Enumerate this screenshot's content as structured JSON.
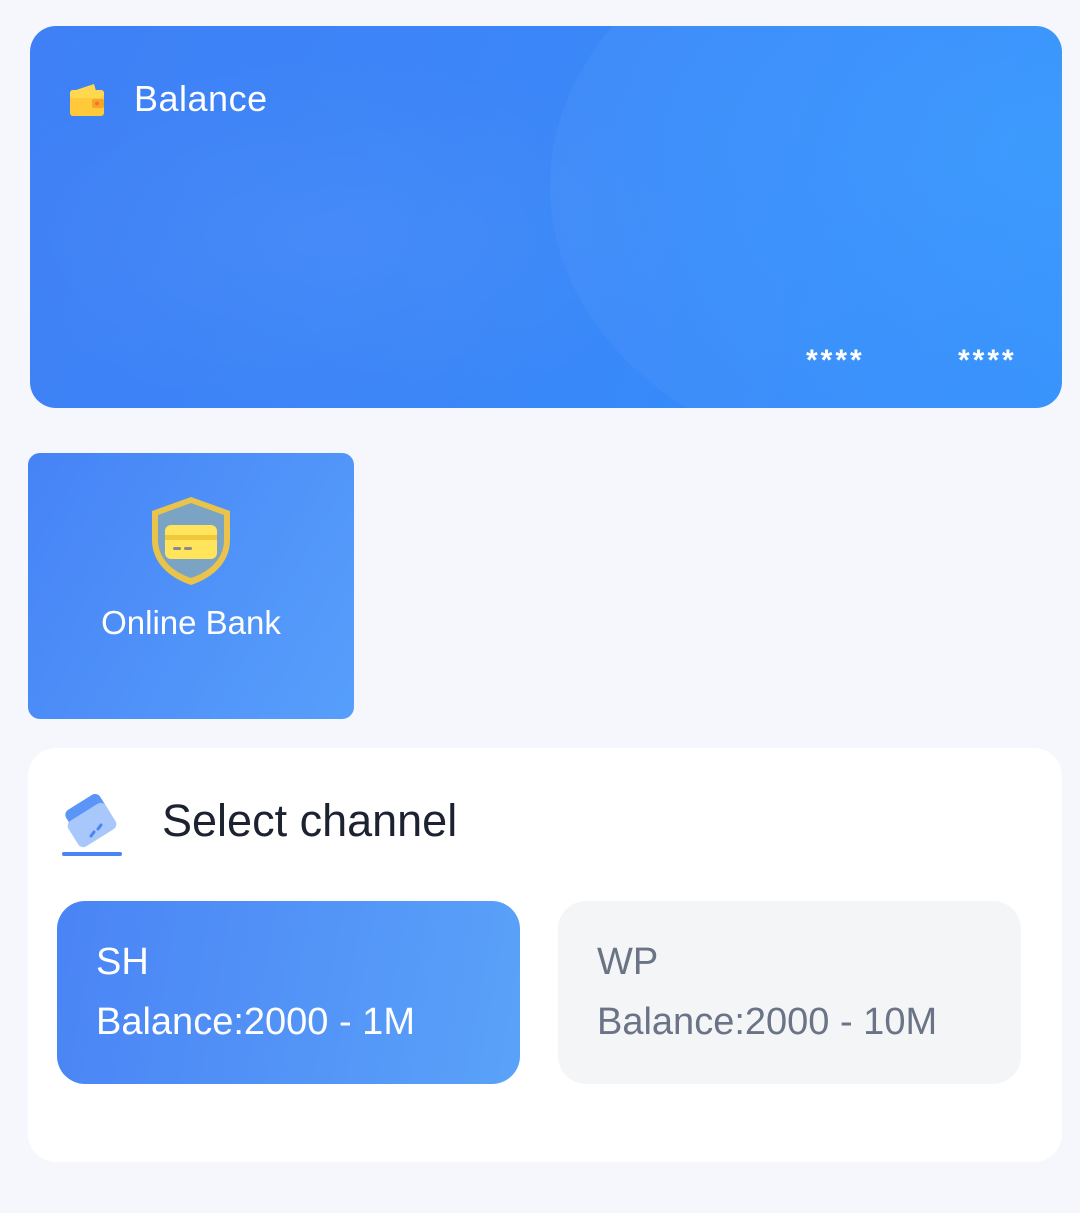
{
  "balance_card": {
    "label": "Balance",
    "masked_1": "****",
    "masked_2": "****",
    "icon": "wallet-icon"
  },
  "online_bank": {
    "label": "Online Bank",
    "icon": "shield-card-icon"
  },
  "channel_section": {
    "title": "Select channel",
    "icon": "card-icon",
    "channels": [
      {
        "code": "SH",
        "range": "Balance:2000 - 1M",
        "selected": true
      },
      {
        "code": "WP",
        "range": "Balance:2000 - 10M",
        "selected": false
      }
    ]
  },
  "colors": {
    "primary_blue": "#3b86f8",
    "page_background": "#f5f7fc",
    "unselected_channel": "#f4f5f7",
    "icon_yellow": "#ffd84f"
  }
}
